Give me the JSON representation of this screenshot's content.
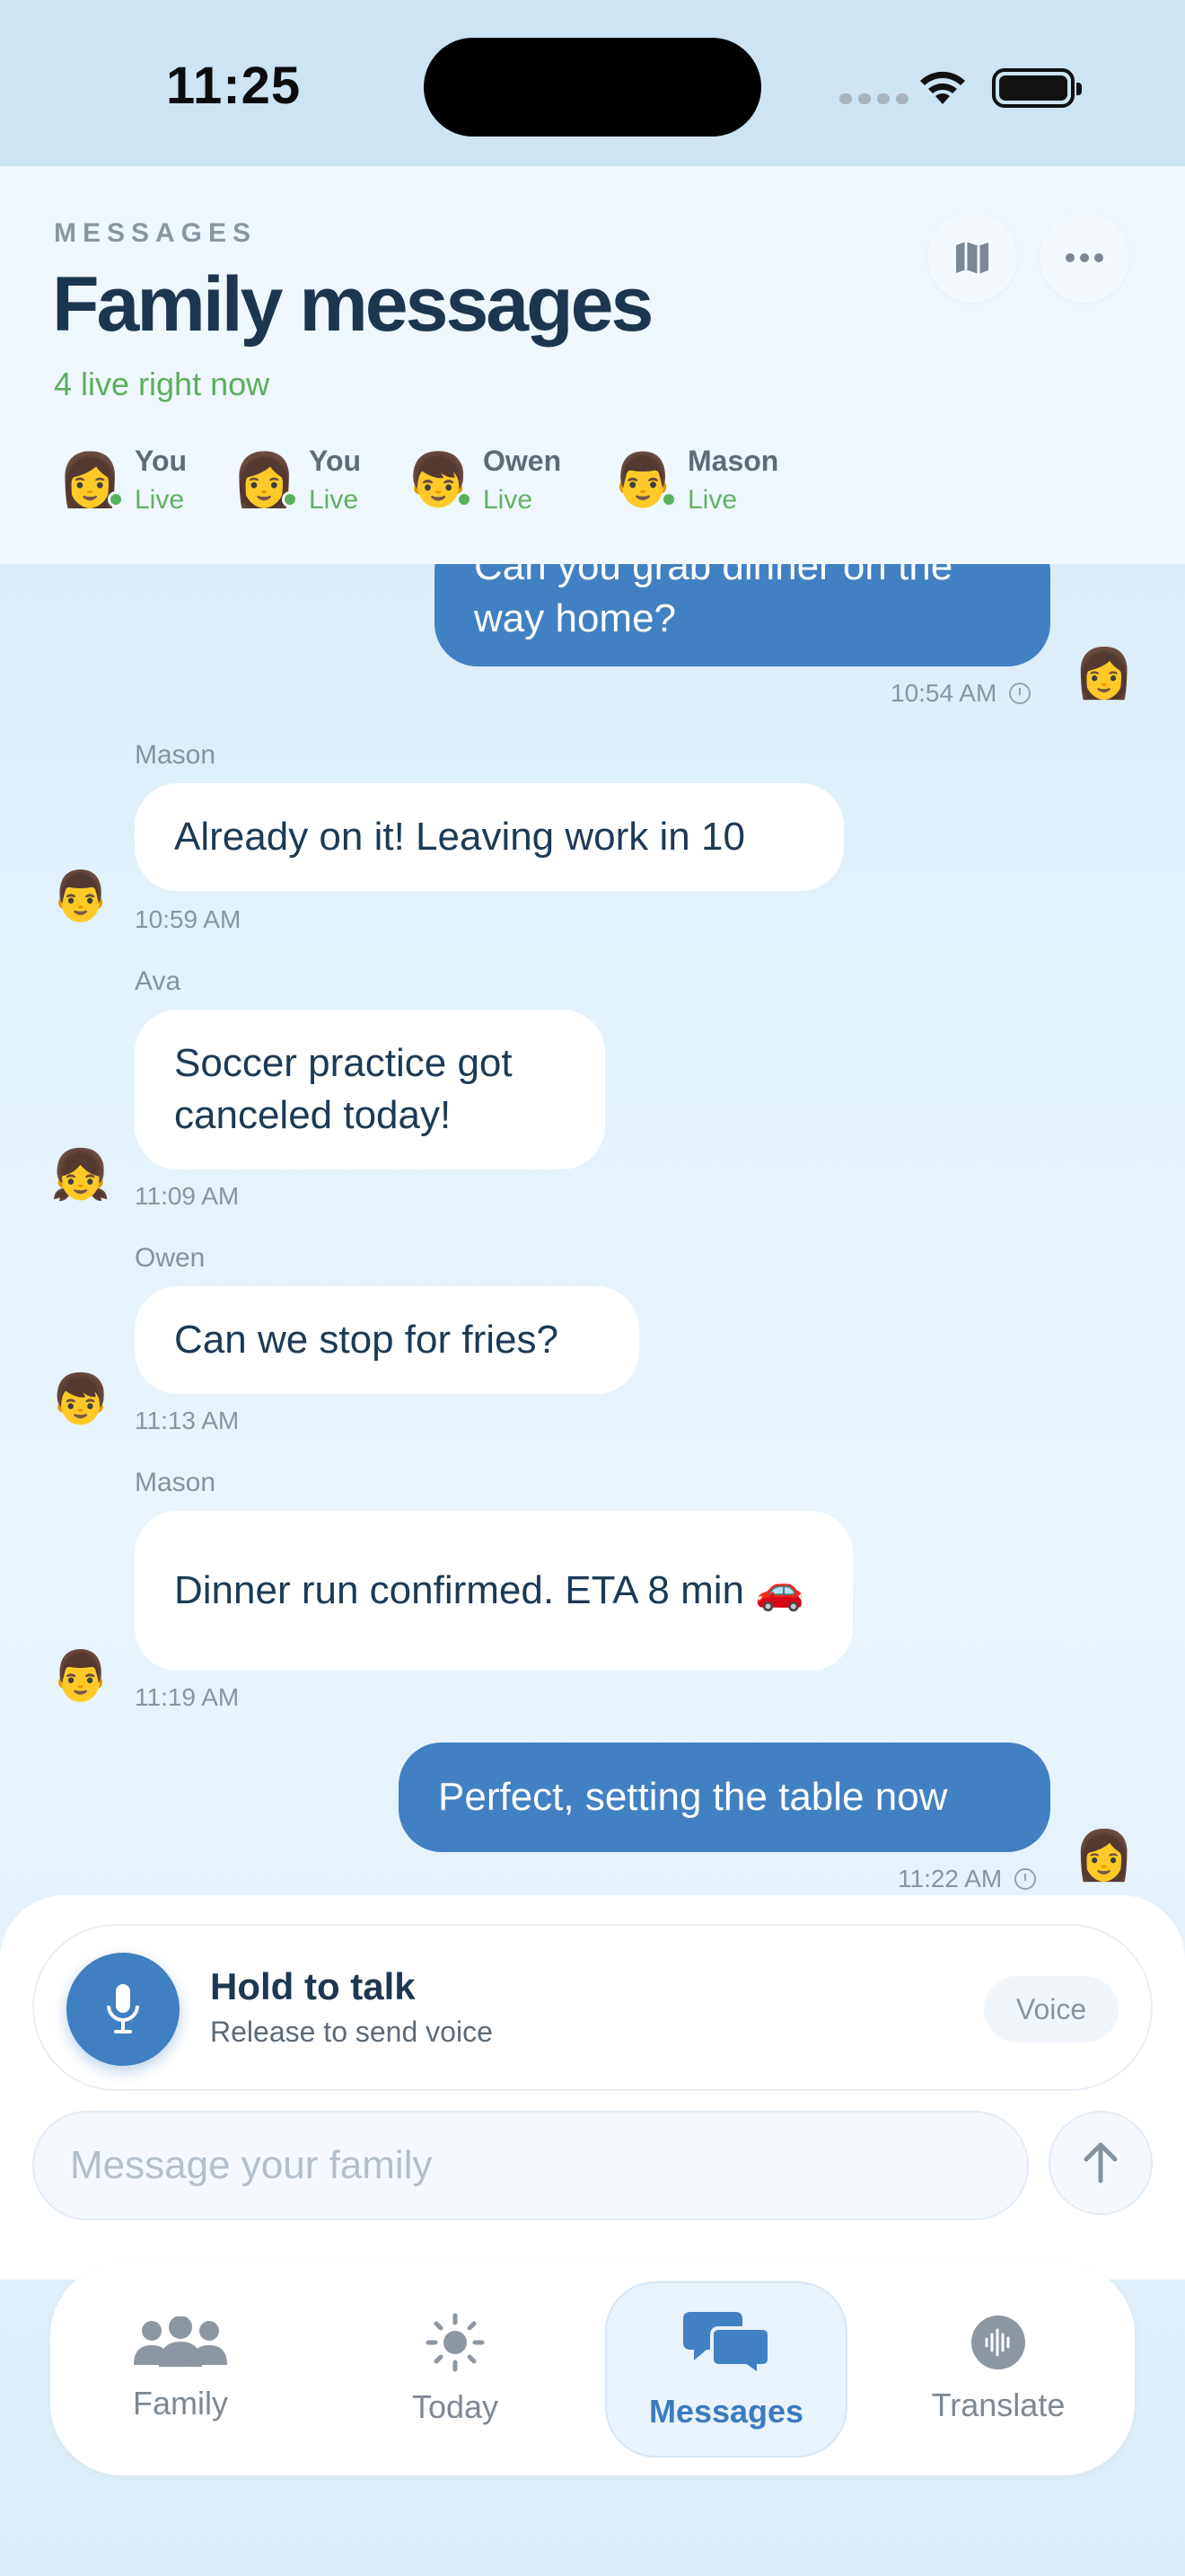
{
  "status_bar": {
    "time": "11:25"
  },
  "header": {
    "eyebrow": "MESSAGES",
    "title": "Family messages",
    "live_count": "4 live right now",
    "members": [
      {
        "name": "You",
        "status": "Live",
        "avatar": "👩"
      },
      {
        "name": "You",
        "status": "Live",
        "avatar": "👩"
      },
      {
        "name": "Owen",
        "status": "Live",
        "avatar": "👦"
      },
      {
        "name": "Mason",
        "status": "Live",
        "avatar": "👨"
      }
    ]
  },
  "messages": [
    {
      "direction": "out",
      "text": "Can you grab dinner on the way home?",
      "time": "10:54 AM",
      "avatar": "👩"
    },
    {
      "direction": "in",
      "sender": "Mason",
      "text": "Already on it! Leaving work in 10",
      "time": "10:59 AM",
      "avatar": "👨"
    },
    {
      "direction": "in",
      "sender": "Ava",
      "text": "Soccer practice got canceled today!",
      "time": "11:09 AM",
      "avatar": "👧"
    },
    {
      "direction": "in",
      "sender": "Owen",
      "text": "Can we stop for fries?",
      "time": "11:13 AM",
      "avatar": "👦"
    },
    {
      "direction": "in",
      "sender": "Mason",
      "text": "Dinner run confirmed. ETA 8 min 🚗",
      "time": "11:19 AM",
      "avatar": "👨"
    },
    {
      "direction": "out",
      "text": "Perfect, setting the table now",
      "time": "11:22 AM",
      "avatar": "👩"
    }
  ],
  "composer": {
    "hold_title": "Hold to talk",
    "hold_subtitle": "Release to send voice",
    "voice_label": "Voice",
    "placeholder": "Message your family"
  },
  "tabs": [
    {
      "label": "Family",
      "icon": "people-icon"
    },
    {
      "label": "Today",
      "icon": "sun-icon"
    },
    {
      "label": "Messages",
      "icon": "chat-bubbles-icon",
      "active": true
    },
    {
      "label": "Translate",
      "icon": "waveform-icon"
    }
  ],
  "colors": {
    "accent": "#4180c2",
    "live": "#5cae5c",
    "title": "#1b3651"
  }
}
